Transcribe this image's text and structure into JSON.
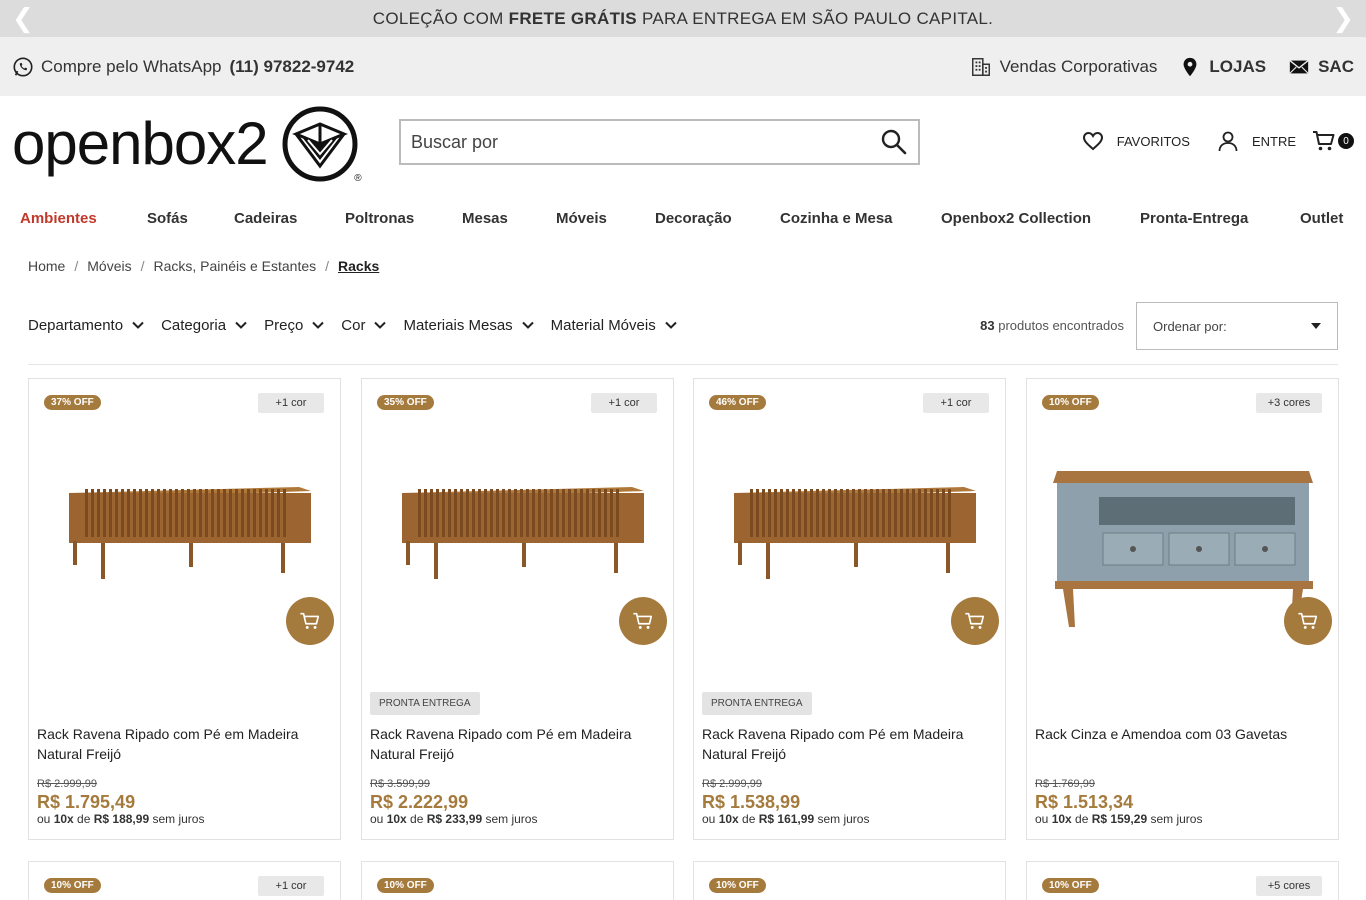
{
  "promo": {
    "prefix": "COLEÇÃO COM ",
    "bold": "FRETE GRÁTIS",
    "suffix": " PARA ENTREGA EM SÃO PAULO CAPITAL.",
    "prev": "❮",
    "next": "❯"
  },
  "util": {
    "whatsapp_label": "Compre pelo WhatsApp",
    "whatsapp_phone": "(11) 97822-9742",
    "corporate": "Vendas Corporativas",
    "stores": "LOJAS",
    "sac": "SAC"
  },
  "header": {
    "logo_text": "openbox2",
    "logo_reg": "®",
    "search_placeholder": "Buscar por",
    "favorites": "FAVORITOS",
    "login": "ENTRE",
    "cart_count": "0"
  },
  "nav": [
    {
      "label": "Ambientes",
      "active": true
    },
    {
      "label": "Sofás"
    },
    {
      "label": "Cadeiras"
    },
    {
      "label": "Poltronas"
    },
    {
      "label": "Mesas"
    },
    {
      "label": "Móveis"
    },
    {
      "label": "Decoração"
    },
    {
      "label": "Cozinha e Mesa"
    },
    {
      "label": "Openbox2 Collection"
    },
    {
      "label": "Pronta-Entrega"
    },
    {
      "label": "Outlet"
    }
  ],
  "breadcrumb": [
    "Home",
    "Móveis",
    "Racks, Painéis e Estantes",
    "Racks"
  ],
  "filters": [
    "Departamento",
    "Categoria",
    "Preço",
    "Cor",
    "Materiais Mesas",
    "Material Móveis"
  ],
  "results": {
    "count": "83",
    "label": " produtos encontrados"
  },
  "sort": {
    "label": "Ordenar por:"
  },
  "colors": {
    "accent": "#a57a3d",
    "active_nav": "#c0392b",
    "wood": "#9c6430",
    "blue_gray": "#8ea0ab"
  },
  "products": [
    {
      "discount": "37% OFF",
      "colors_badge": "+1 cor",
      "pronta": "",
      "name": "Rack Ravena Ripado com Pé em Madeira Natural Freijó",
      "old_price": "R$ 2.999,99",
      "price": "R$ 1.795,49",
      "inst_pre": "ou ",
      "inst_times": "10x",
      "inst_mid": " de ",
      "inst_value": "R$ 188,99",
      "inst_post": " sem juros",
      "image": "wood-slatted-rack"
    },
    {
      "discount": "35% OFF",
      "colors_badge": "+1 cor",
      "pronta": "PRONTA ENTREGA",
      "name": "Rack Ravena Ripado com Pé em Madeira Natural Freijó",
      "old_price": "R$ 3.599,99",
      "price": "R$ 2.222,99",
      "inst_pre": "ou ",
      "inst_times": "10x",
      "inst_mid": " de ",
      "inst_value": "R$ 233,99",
      "inst_post": " sem juros",
      "image": "wood-slatted-rack"
    },
    {
      "discount": "46% OFF",
      "colors_badge": "+1 cor",
      "pronta": "PRONTA ENTREGA",
      "name": "Rack Ravena Ripado com Pé em Madeira Natural Freijó",
      "old_price": "R$ 2.999,99",
      "price": "R$ 1.538,99",
      "inst_pre": "ou ",
      "inst_times": "10x",
      "inst_mid": " de ",
      "inst_value": "R$ 161,99",
      "inst_post": " sem juros",
      "image": "wood-slatted-rack"
    },
    {
      "discount": "10% OFF",
      "colors_badge": "+3 cores",
      "pronta": "",
      "name": "Rack Cinza e Amendoa com 03 Gavetas",
      "old_price": "R$ 1.769,99",
      "price": "R$ 1.513,34",
      "inst_pre": "ou ",
      "inst_times": "10x",
      "inst_mid": " de ",
      "inst_value": "R$ 159,29",
      "inst_post": " sem juros",
      "image": "gray-drawer-rack"
    }
  ],
  "products_row2": [
    {
      "discount": "10% OFF",
      "colors_badge": "+1 cor"
    },
    {
      "discount": "10% OFF",
      "colors_badge": ""
    },
    {
      "discount": "10% OFF",
      "colors_badge": ""
    },
    {
      "discount": "10% OFF",
      "colors_badge": "+5 cores"
    }
  ]
}
